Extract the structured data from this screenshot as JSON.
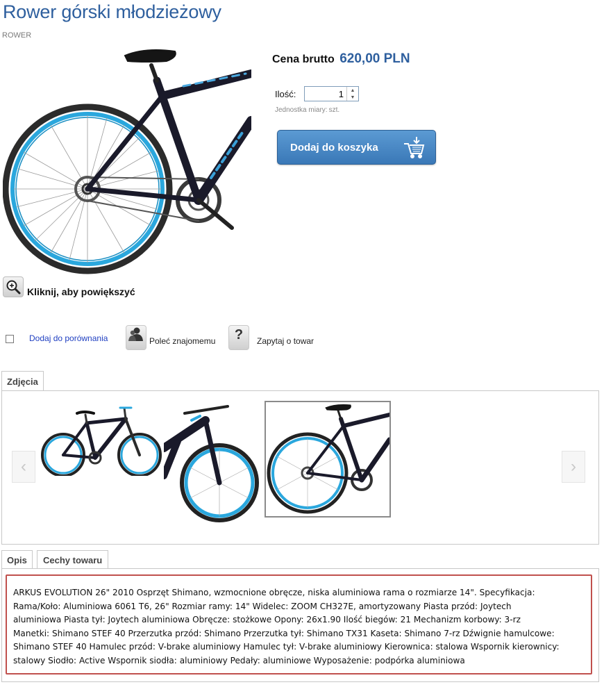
{
  "product": {
    "title": "Rower górski młodzieżowy",
    "category": "ROWER"
  },
  "zoom": {
    "label": "Kliknij, aby powiększyć"
  },
  "price": {
    "label": "Cena brutto",
    "value": "620,00 PLN"
  },
  "quantity": {
    "label": "Ilość:",
    "value": "1",
    "unit_label": "Jednostka miary:",
    "unit_value": "szt."
  },
  "cart": {
    "button_label": "Dodaj do koszyka"
  },
  "actions": {
    "compare_label": "Dodaj do porównania",
    "recommend_label": "Poleć znajomemu",
    "ask_label": "Zapytaj o towar",
    "ask_icon_glyph": "?"
  },
  "gallery": {
    "tab_label": "Zdjęcia",
    "prev": "‹",
    "next": "›"
  },
  "details": {
    "tabs": [
      "Opis",
      "Cechy towaru"
    ],
    "description_lines": [
      "ARKUS EVOLUTION 26\" 2010 Osprzęt Shimano, wzmocnione obręcze, niska aluminiowa rama o rozmiarze 14\". Specyfikacja:",
      "Rama/Koło: Aluminiowa 6061 T6, 26\" Rozmiar ramy: 14\" Widelec: ZOOM CH327E, amortyzowany Piasta przód: Joytech",
      "aluminiowa Piasta tył: Joytech aluminiowa Obręcze: stożkowe Opony: 26x1.90 Ilość biegów: 21 Mechanizm korbowy: 3-rz",
      "Manetki: Shimano STEF 40 Przerzutka przód: Shimano Przerzutka tył: Shimano TX31 Kaseta: Shimano 7-rz Dźwignie hamulcowe:",
      "Shimano STEF 40 Hamulec przód: V-brake aluminiowy Hamulec tył: V-brake aluminiowy Kierownica: stalowa Wspornik kierownicy:",
      "stalowy Siodło: Active Wspornik siodła: aluminiowy Pedały: aluminiowe Wyposażenie: podpórka aluminiowa"
    ]
  },
  "colors": {
    "title_blue": "#2e5f9e",
    "button_blue": "#4a88c6",
    "rim_blue": "#2aa7dd",
    "highlight_red": "#c0504d"
  },
  "icons": [
    "zoom-in-icon",
    "cart-icon",
    "recommend-person-icon",
    "question-icon",
    "chevron-left-icon",
    "chevron-right-icon"
  ]
}
